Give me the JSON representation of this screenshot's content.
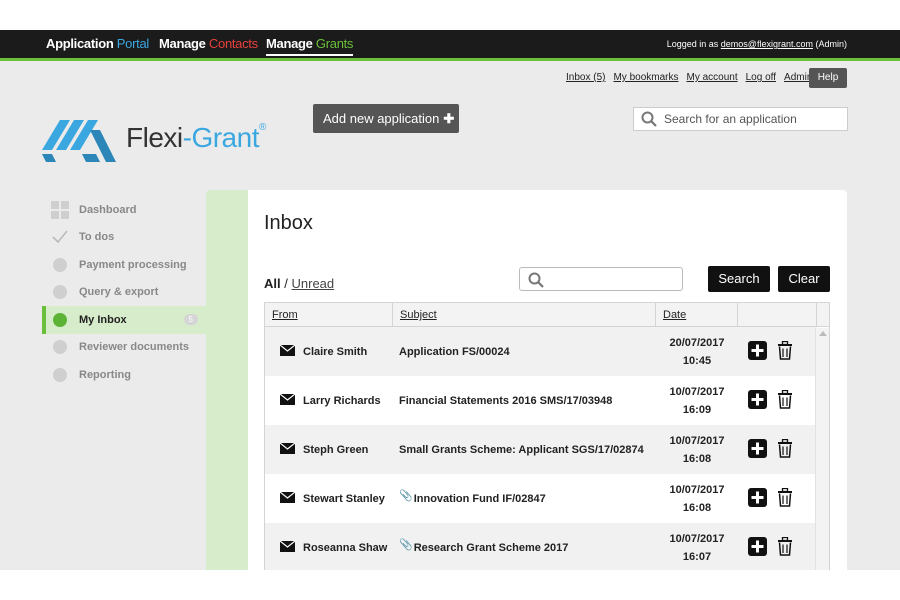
{
  "nav": {
    "items": [
      {
        "w": "Application",
        "c": "Portal"
      },
      {
        "w": "Manage",
        "c": "Contacts"
      },
      {
        "w": "Manage",
        "c": "Grants"
      }
    ],
    "logged_prefix": "Logged in as",
    "logged_email": "demos@flexigrant.com",
    "logged_role": "(Admin)"
  },
  "links": [
    "Inbox (5)",
    "My bookmarks",
    "My account",
    "Log off",
    "Admin"
  ],
  "help_label": "Help",
  "logo": {
    "part1": "Flexi",
    "part2": "-Grant",
    "mark": "®"
  },
  "add_label": "Add new application",
  "search_placeholder": "Search for an application",
  "sidebar": {
    "items": [
      {
        "label": "Dashboard",
        "icon": "dashboard-icon"
      },
      {
        "label": "To dos",
        "icon": "check-icon"
      },
      {
        "label": "Payment processing",
        "icon": "circle-icon"
      },
      {
        "label": "Query & export",
        "icon": "circle-icon"
      },
      {
        "label": "My Inbox",
        "icon": "circle-icon",
        "badge": "5"
      },
      {
        "label": "Reviewer documents",
        "icon": "circle-icon"
      },
      {
        "label": "Reporting",
        "icon": "circle-icon"
      }
    ]
  },
  "inbox": {
    "title": "Inbox",
    "filter_all": "All",
    "filter_sep": "/",
    "filter_unread": "Unread",
    "search_button": "Search",
    "clear_button": "Clear",
    "columns": [
      "From",
      "Subject",
      "Date"
    ],
    "rows": [
      {
        "from": "Claire Smith",
        "subject": "Application FS/00024",
        "date": "20/07/2017",
        "time": "10:45",
        "attach": false
      },
      {
        "from": "Larry Richards",
        "subject": "Financial Statements 2016 SMS/17/03948",
        "date": "10/07/2017",
        "time": "16:09",
        "attach": false
      },
      {
        "from": "Steph Green",
        "subject": "Small Grants Scheme: Applicant SGS/17/02874",
        "date": "10/07/2017",
        "time": "16:08",
        "attach": false
      },
      {
        "from": "Stewart Stanley",
        "subject": "Innovation Fund IF/02847",
        "date": "10/07/2017",
        "time": "16:08",
        "attach": true
      },
      {
        "from": "Roseanna Shaw",
        "subject": "Research Grant Scheme 2017",
        "date": "10/07/2017",
        "time": "16:07",
        "attach": true
      }
    ]
  },
  "colors": {
    "accent_green": "#6bbf3a",
    "accent_blue": "#3ba7e0",
    "accent_red": "#e8413c"
  }
}
